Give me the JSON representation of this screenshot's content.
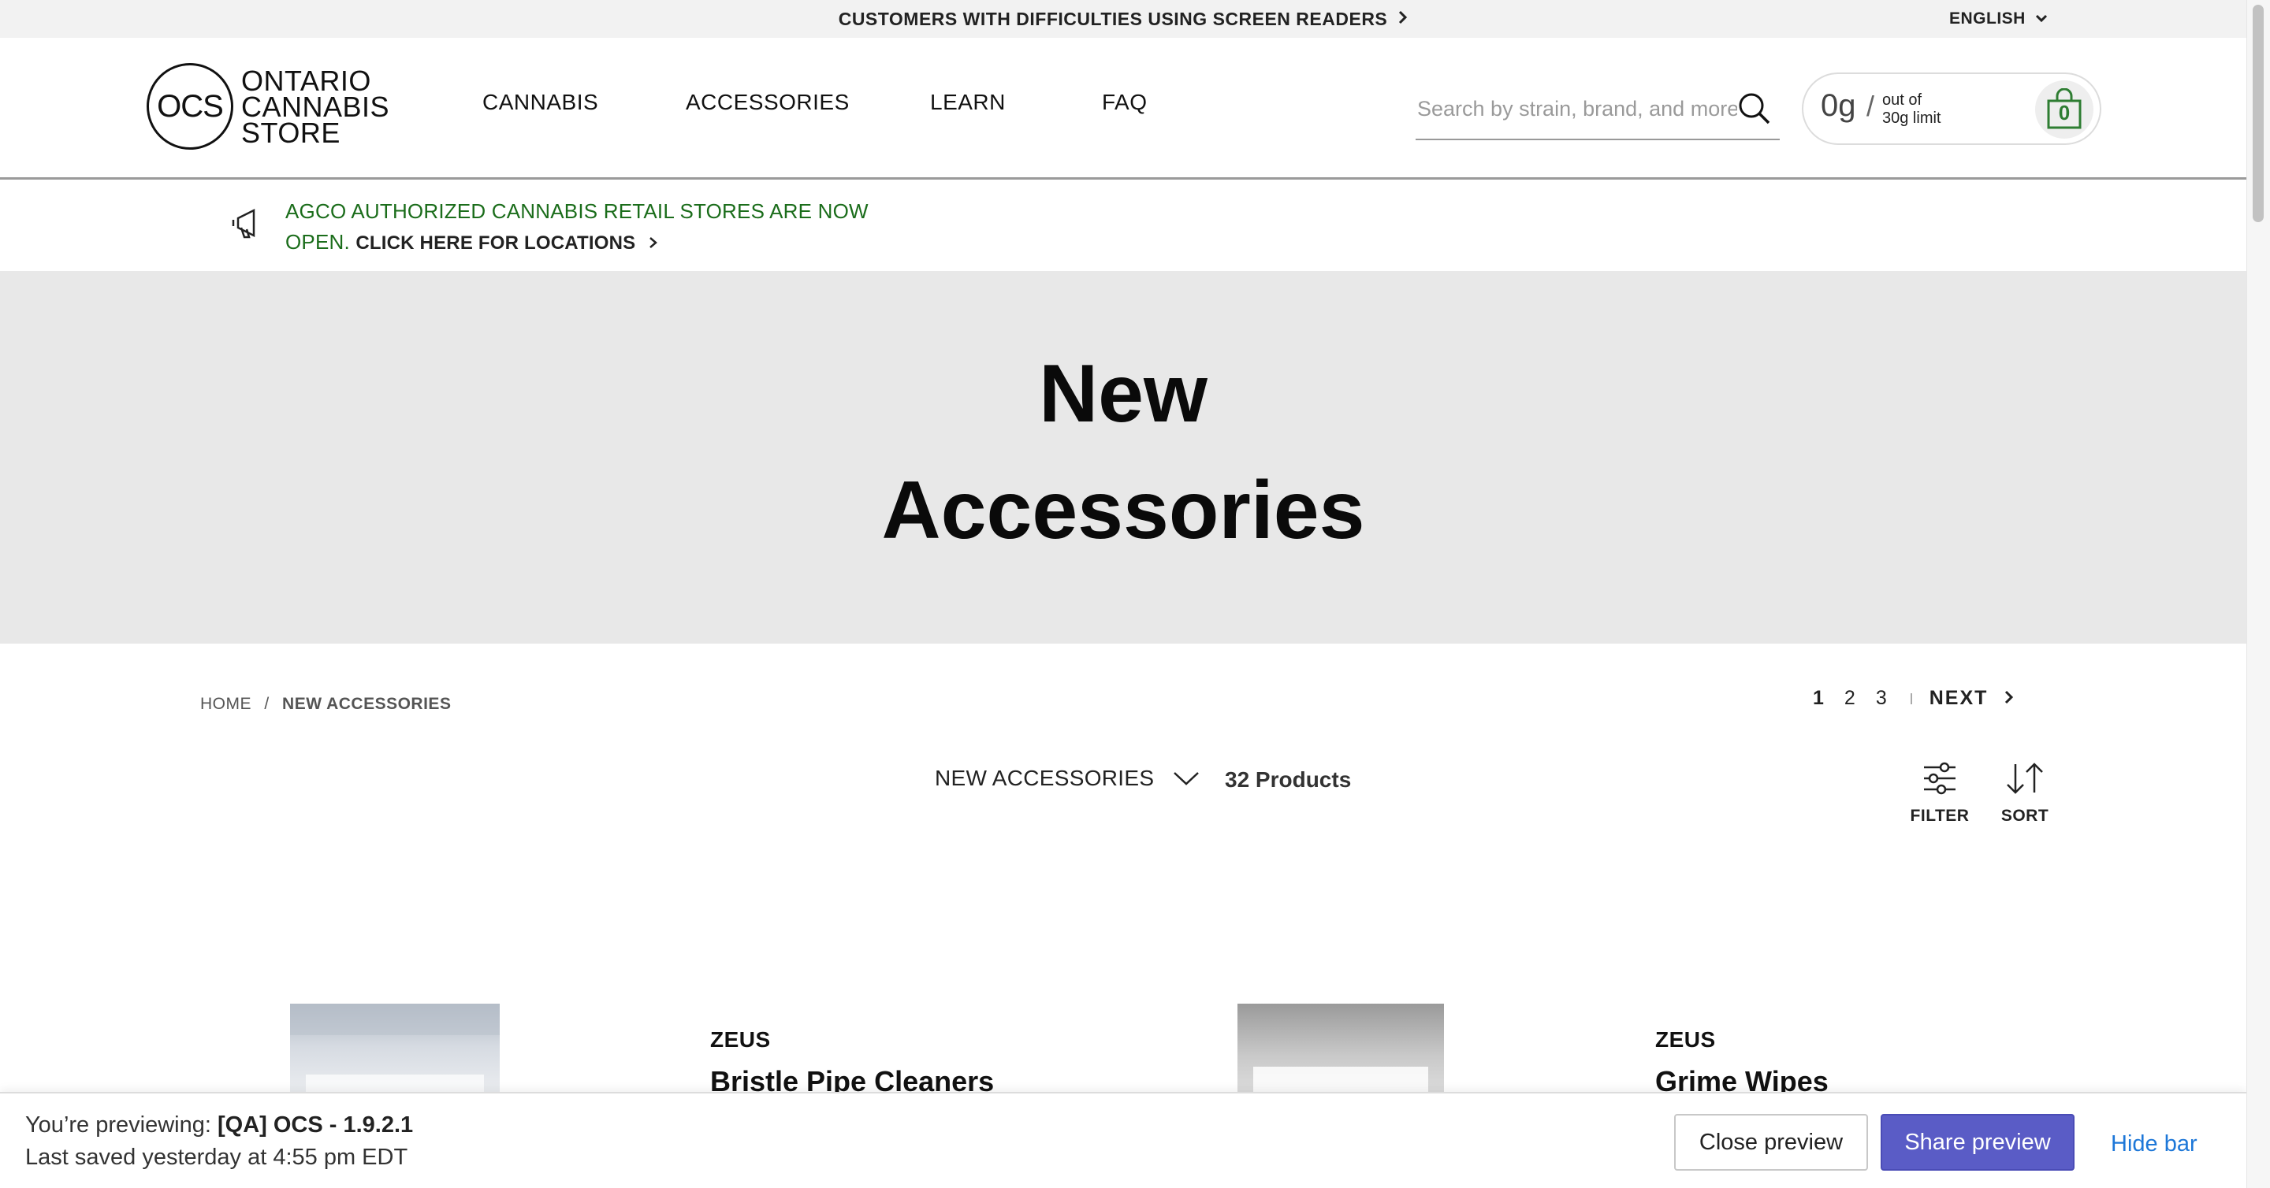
{
  "topbar": {
    "screen_reader_link": "CUSTOMERS WITH DIFFICULTIES USING SCREEN READERS",
    "language": "ENGLISH"
  },
  "header": {
    "logo_mark": "OCS",
    "logo_lines": [
      "ONTARIO",
      "CANNABIS",
      "STORE"
    ],
    "nav": [
      "CANNABIS",
      "ACCESSORIES",
      "LEARN",
      "FAQ"
    ],
    "search_placeholder": "Search by strain, brand, and more",
    "cart": {
      "grams": "0g",
      "slash": "/",
      "limit_line1": "out of",
      "limit_line2": "30g limit",
      "count": "0"
    }
  },
  "announcement": {
    "text": "AGCO AUTHORIZED CANNABIS RETAIL STORES ARE NOW OPEN.",
    "cta": "CLICK HERE FOR LOCATIONS"
  },
  "hero": {
    "line1": "New",
    "line2": "Accessories"
  },
  "breadcrumb": {
    "home": "HOME",
    "separator": "/",
    "current": "NEW ACCESSORIES"
  },
  "pagination": {
    "pages": [
      "1",
      "2",
      "3"
    ],
    "active": "1",
    "next": "NEXT"
  },
  "category": {
    "selected": "NEW ACCESSORIES",
    "product_count": "32 Products"
  },
  "tools": {
    "filter": "FILTER",
    "sort": "SORT"
  },
  "products": [
    {
      "brand": "ZEUS",
      "name": "Bristle Pipe Cleaners"
    },
    {
      "brand": "ZEUS",
      "name": "Grime Wipes"
    }
  ],
  "preview_bar": {
    "label": "You’re previewing:",
    "theme": "[QA] OCS - 1.9.2.1",
    "saved": "Last saved yesterday at 4:55 pm EDT",
    "close": "Close preview",
    "share": "Share preview",
    "hide": "Hide bar"
  },
  "colors": {
    "announcement_green": "#1b6d1b",
    "share_button": "#5a5cc6",
    "hide_link": "#1d77d8",
    "hero_bg": "#e8e8e8"
  }
}
